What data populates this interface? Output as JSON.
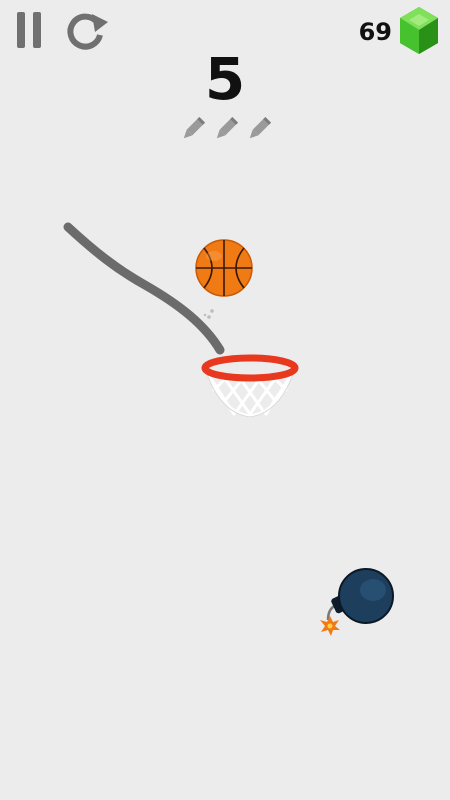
{
  "hud": {
    "score": "5",
    "gem_count": "69",
    "pencils_remaining": 3
  },
  "icons": {
    "pause": "pause-icon",
    "restart": "restart-icon",
    "gem": "gem-icon",
    "pencil": "pencil-icon",
    "ball": "basketball-icon",
    "hoop": "hoop-icon",
    "bomb": "bomb-icon"
  },
  "colors": {
    "background": "#ececec",
    "hud_icon": "#707070",
    "drawn_line": "#6b6b6b",
    "ball": "#f07a14",
    "rim": "#e8391f",
    "gem": "#3ec42b",
    "bomb": "#1d3e5c"
  }
}
